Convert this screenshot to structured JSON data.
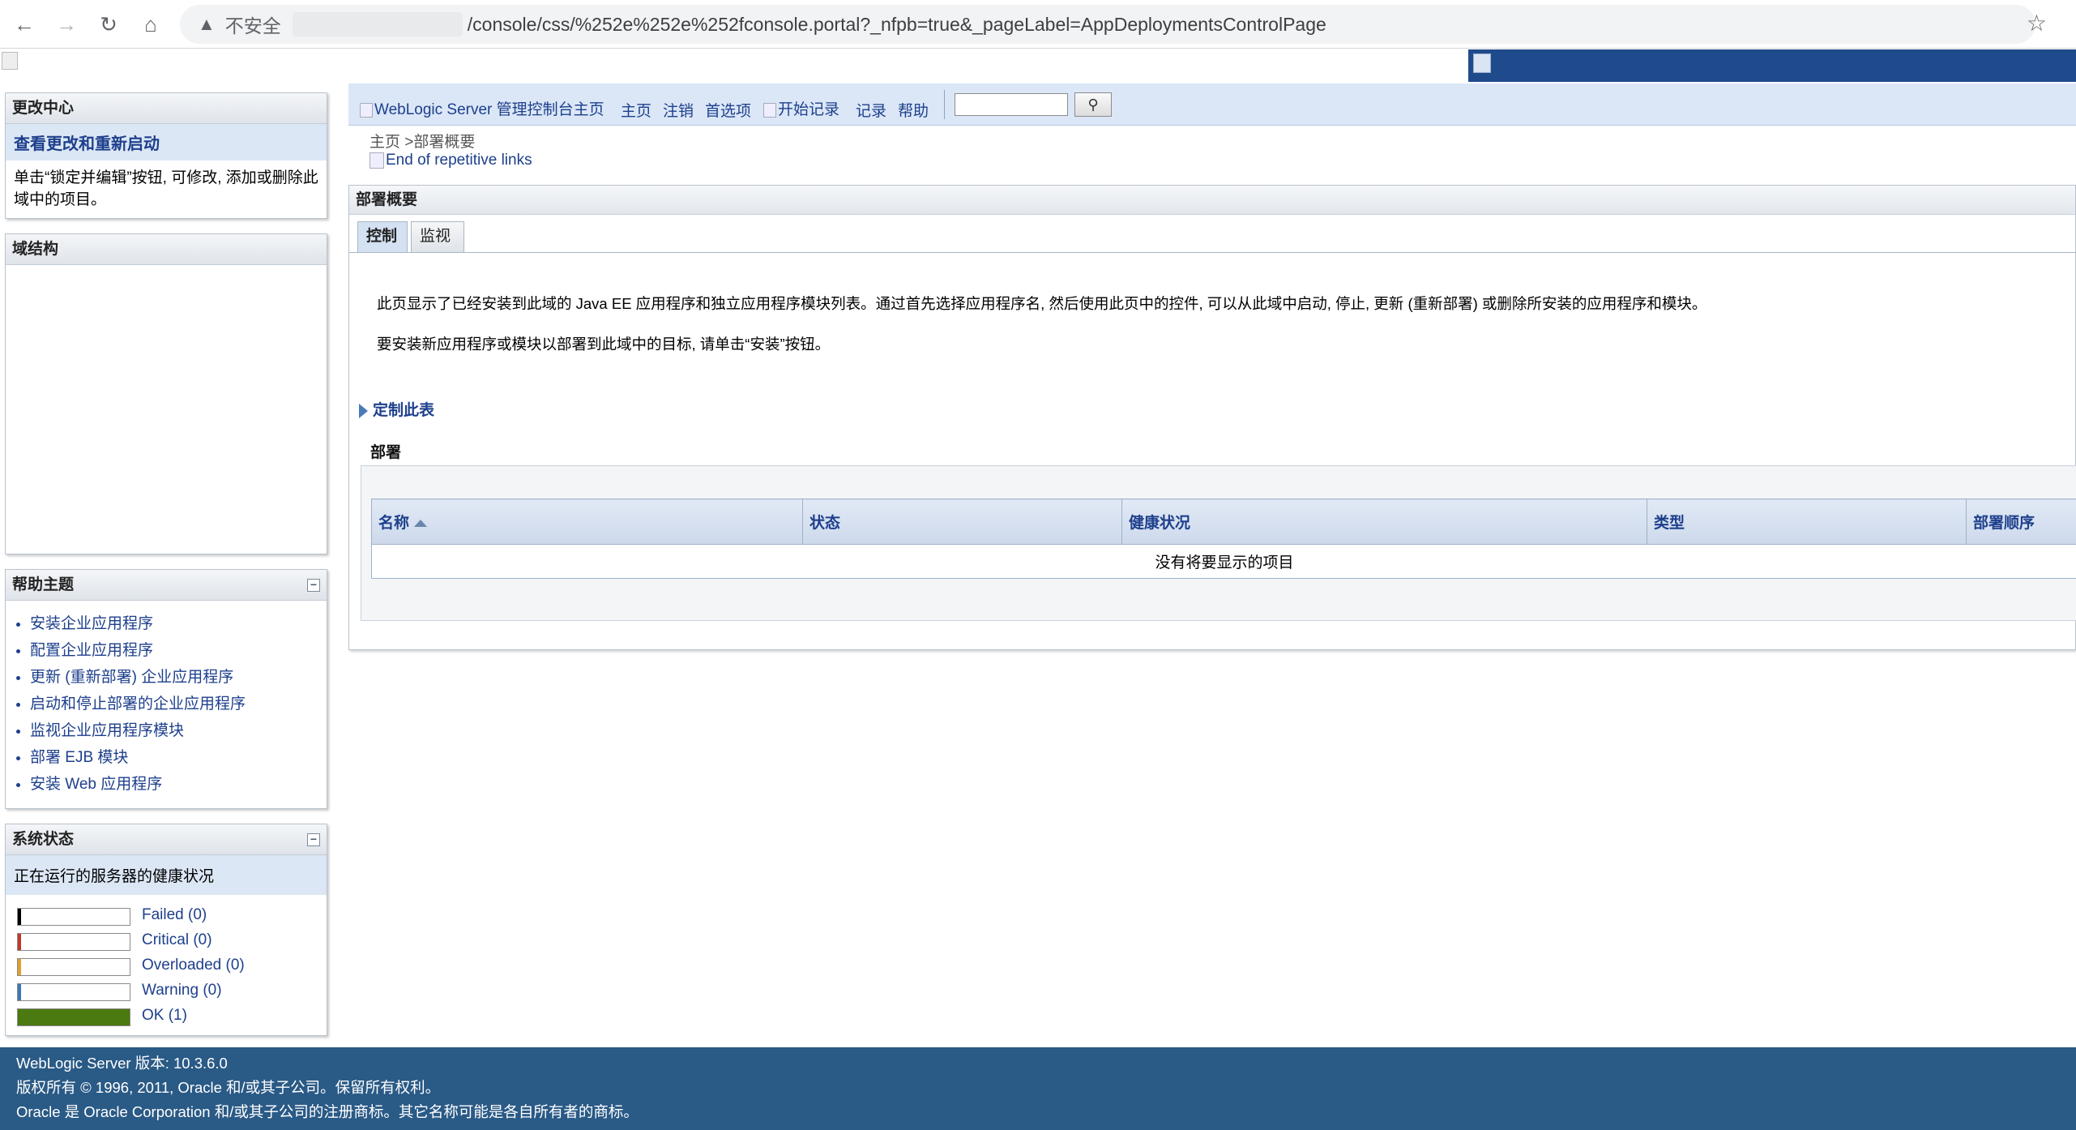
{
  "browser": {
    "insecure_label": "不安全",
    "url_tail": "/console/css/%252e%252e%252fconsole.portal?_nfpb=true&_pageLabel=AppDeploymentsControlPage"
  },
  "change_center": {
    "title": "更改中心",
    "link": "查看更改和重新启动",
    "text": "单击“锁定并编辑”按钮, 可修改, 添加或删除此域中的项目。"
  },
  "domain_structure": {
    "title": "域结构"
  },
  "help_topics": {
    "title": "帮助主题",
    "items": [
      "安装企业应用程序",
      "配置企业应用程序",
      "更新 (重新部署) 企业应用程序",
      "启动和停止部署的企业应用程序",
      "监视企业应用程序模块",
      "部署 EJB 模块",
      "安装 Web 应用程序"
    ]
  },
  "system_status": {
    "title": "系统状态",
    "subtitle": "正在运行的服务器的健康状况",
    "rows": [
      {
        "label": "Failed (0)",
        "color": "#000000",
        "fill": 0
      },
      {
        "label": "Critical (0)",
        "color": "#c0392b",
        "fill": 0
      },
      {
        "label": "Overloaded (0)",
        "color": "#e0a030",
        "fill": 0
      },
      {
        "label": "Warning (0)",
        "color": "#3b78b5",
        "fill": 0
      },
      {
        "label": "OK (1)",
        "color": "#4a7a10",
        "fill": 1
      }
    ]
  },
  "toolbar": {
    "console_home": "WebLogic Server 管理控制台主页",
    "home": "主页",
    "logout": "注销",
    "preferences": "首选项",
    "start_recording": "开始记录",
    "record": "记录",
    "help": "帮助"
  },
  "breadcrumb": {
    "home": "主页",
    "separator": ">",
    "current": "部署概要"
  },
  "skip_link": "End of repetitive links",
  "content": {
    "title": "部署概要",
    "tabs": [
      "控制",
      "监视"
    ],
    "description_1": "此页显示了已经安装到此域的 Java EE 应用程序和独立应用程序模块列表。通过首先选择应用程序名, 然后使用此页中的控件, 可以从此域中启动, 停止, 更新 (重新部署) 或删除所安装的应用程序和模块。",
    "description_2": "要安装新应用程序或模块以部署到此域中的目标, 请单击“安装”按钮。",
    "customize": "定制此表",
    "table_caption": "部署",
    "columns": [
      "名称",
      "状态",
      "健康状况",
      "类型",
      "部署顺序"
    ],
    "empty_message": "没有将要显示的项目"
  },
  "footer": {
    "line1": "WebLogic Server 版本: 10.3.6.0",
    "line2": "版权所有 © 1996, 2011, Oracle 和/或其子公司。保留所有权利。",
    "line3": "Oracle 是 Oracle Corporation 和/或其子公司的注册商标。其它名称可能是各自所有者的商标。"
  }
}
